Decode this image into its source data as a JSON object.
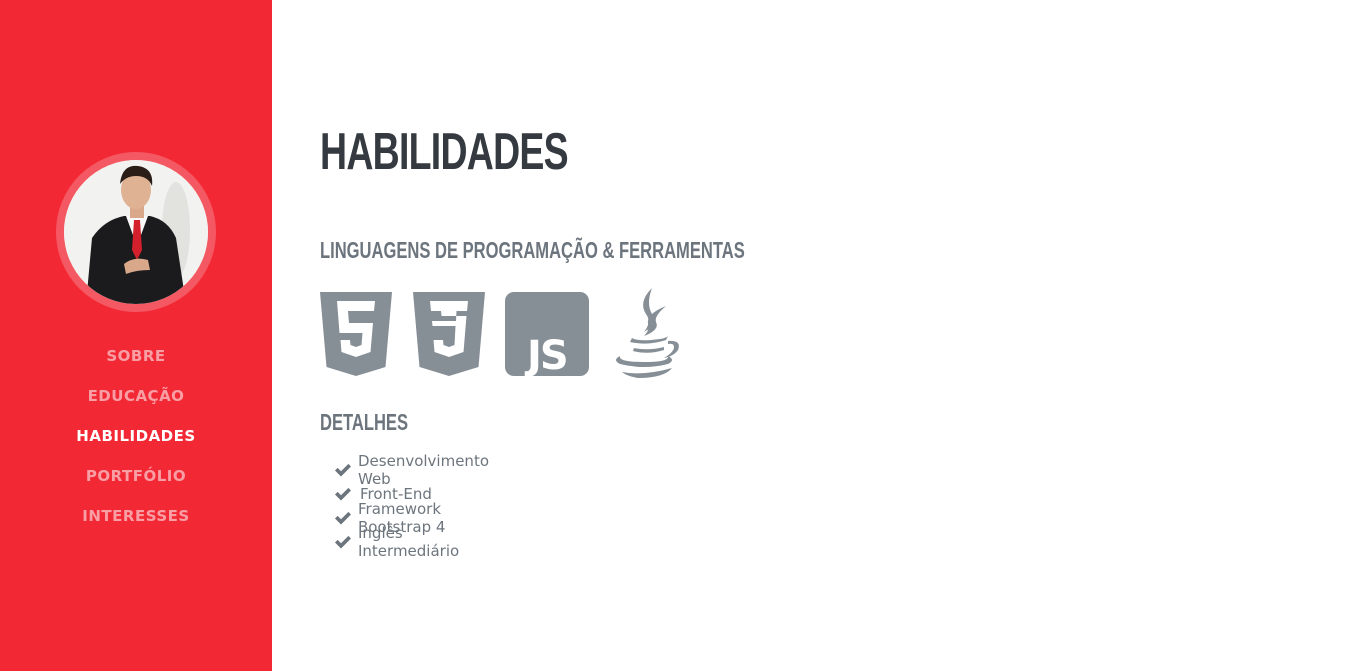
{
  "sidebar": {
    "avatar_alt": "profile photo",
    "nav": [
      {
        "label": "SOBRE",
        "active": false
      },
      {
        "label": "EDUCAÇÃO",
        "active": false
      },
      {
        "label": "HABILIDADES",
        "active": true
      },
      {
        "label": "PORTFÓLIO",
        "active": false
      },
      {
        "label": "INTERESSES",
        "active": false
      }
    ]
  },
  "main": {
    "title": "HABILIDADES",
    "languages_heading": "LINGUAGENS DE PROGRAMAÇÃO & FERRAMENTAS",
    "language_icons": [
      "html5-icon",
      "css3-icon",
      "javascript-icon",
      "java-icon"
    ],
    "details_heading": "DETALHES",
    "details": [
      "Desenvolvimento Web",
      "Front-End",
      "Framework Bootstrap 4",
      "Inglês Intermediário"
    ]
  },
  "colors": {
    "sidebar_bg": "#f22935",
    "heading": "#343a40",
    "subheading": "#6c757d",
    "icon": "#868e96"
  }
}
